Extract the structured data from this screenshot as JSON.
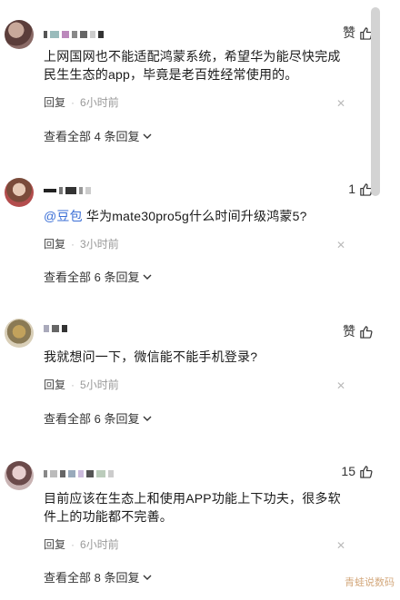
{
  "comments": [
    {
      "text": "上网国网也不能适配鸿蒙系统，希望华为能尽快完成民生生态的app，毕竟是老百姓经常使用的。",
      "like_label": "赞",
      "reply_label": "回复",
      "time": "6小时前",
      "view_all": "查看全部 4 条回复"
    },
    {
      "mention": "@豆包",
      "text": " 华为mate30pro5g什么时间升级鸿蒙5?",
      "like_label": "1",
      "reply_label": "回复",
      "time": "3小时前",
      "view_all": "查看全部 6 条回复"
    },
    {
      "text": "我就想问一下，微信能不能手机登录?",
      "like_label": "赞",
      "reply_label": "回复",
      "time": "5小时前",
      "view_all": "查看全部 6 条回复"
    },
    {
      "text": "目前应该在生态上和使用APP功能上下功夫，很多软件上的功能都不完善。",
      "like_label": "15",
      "reply_label": "回复",
      "time": "6小时前",
      "view_all": "查看全部 8 条回复"
    }
  ],
  "watermark": "青蛙说数码",
  "icons": {
    "like": "thumbs-up-icon",
    "close": "close-icon",
    "expand": "chevron-down-icon"
  },
  "colors": {
    "mention": "#3b6fd6",
    "scrollbar": "#d3d3d3"
  }
}
